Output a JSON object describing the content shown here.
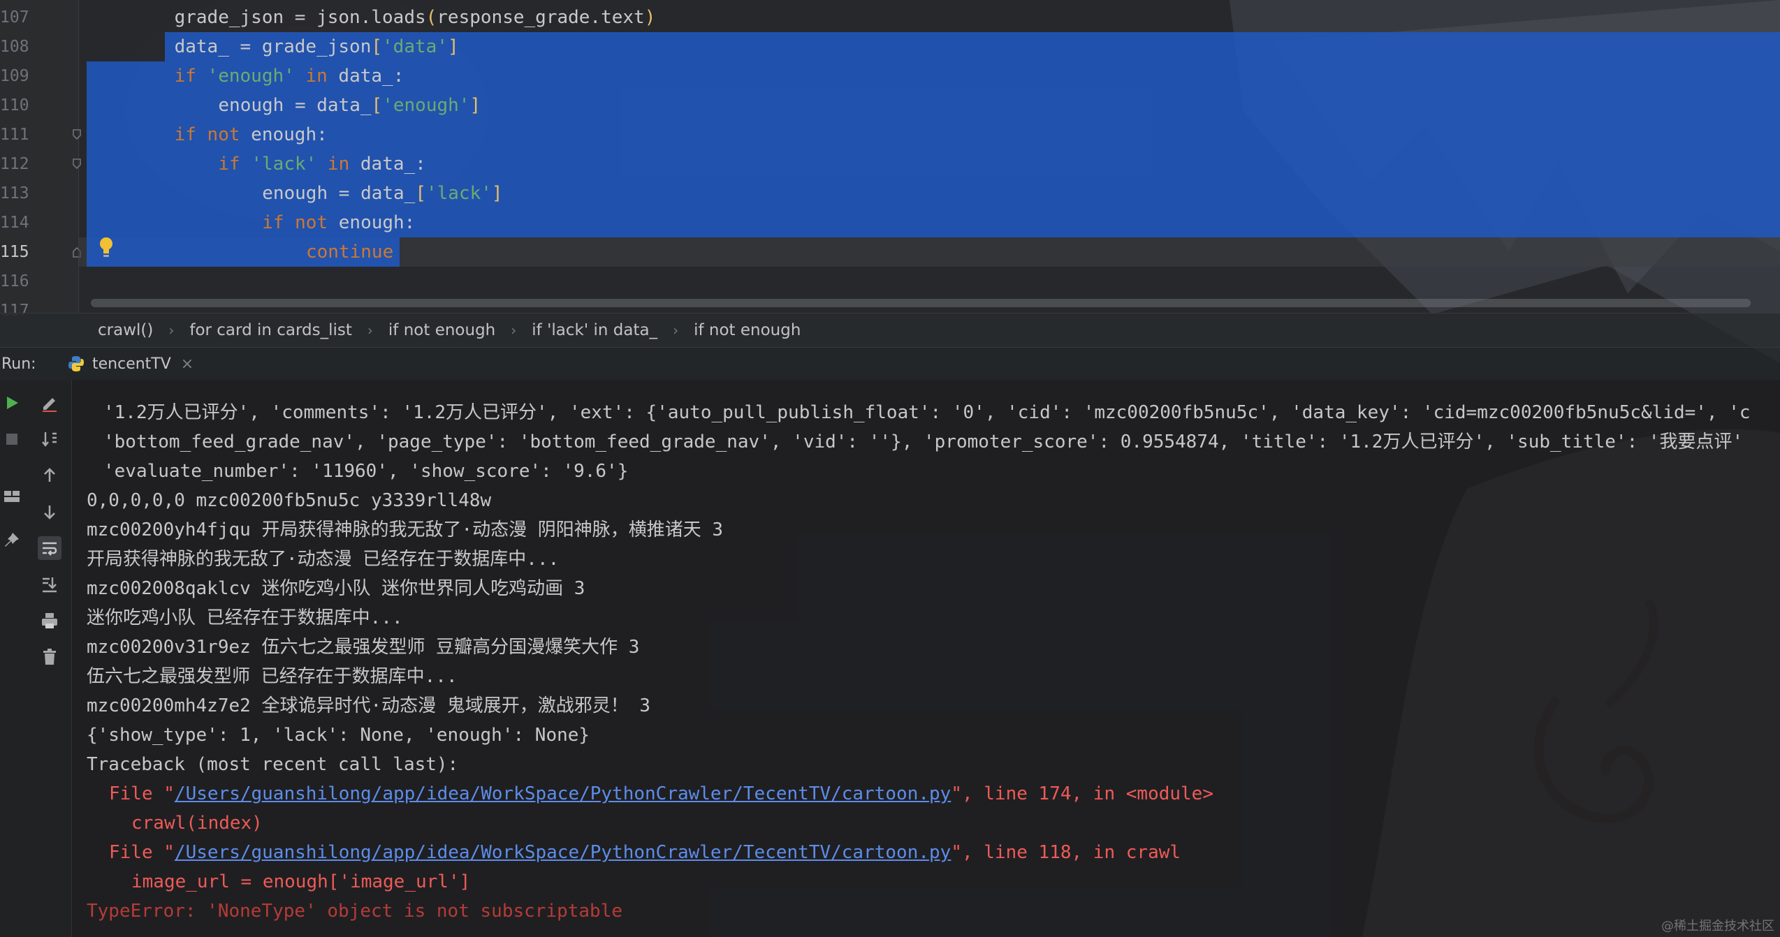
{
  "editor": {
    "line_numbers": [
      "107",
      "108",
      "109",
      "110",
      "111",
      "112",
      "113",
      "114",
      "115",
      "116",
      "117"
    ],
    "lines": [
      {
        "indent": 8,
        "tokens": [
          {
            "t": "grade_json = json.loads",
            "c": ""
          },
          {
            "t": "(",
            "c": "br"
          },
          {
            "t": "response_grade.text",
            "c": ""
          },
          {
            "t": ")",
            "c": "br"
          }
        ]
      },
      {
        "indent": 8,
        "tokens": [
          {
            "t": "data_ = grade_json",
            "c": ""
          },
          {
            "t": "[",
            "c": "br"
          },
          {
            "t": "'data'",
            "c": "str"
          },
          {
            "t": "]",
            "c": "br"
          }
        ]
      },
      {
        "indent": 8,
        "tokens": [
          {
            "t": "if ",
            "c": "kw"
          },
          {
            "t": "'enough'",
            "c": "str"
          },
          {
            "t": " in ",
            "c": "kw"
          },
          {
            "t": "data_:",
            "c": ""
          }
        ]
      },
      {
        "indent": 12,
        "tokens": [
          {
            "t": "enough = data_",
            "c": ""
          },
          {
            "t": "[",
            "c": "br"
          },
          {
            "t": "'enough'",
            "c": "str"
          },
          {
            "t": "]",
            "c": "br"
          }
        ]
      },
      {
        "indent": 8,
        "tokens": [
          {
            "t": "if not ",
            "c": "kw"
          },
          {
            "t": "enough:",
            "c": ""
          }
        ]
      },
      {
        "indent": 12,
        "tokens": [
          {
            "t": "if ",
            "c": "kw"
          },
          {
            "t": "'lack'",
            "c": "str"
          },
          {
            "t": " in ",
            "c": "kw"
          },
          {
            "t": "data_:",
            "c": ""
          }
        ]
      },
      {
        "indent": 16,
        "tokens": [
          {
            "t": "enough = data_",
            "c": ""
          },
          {
            "t": "[",
            "c": "br"
          },
          {
            "t": "'lack'",
            "c": "str"
          },
          {
            "t": "]",
            "c": "br"
          }
        ]
      },
      {
        "indent": 16,
        "tokens": [
          {
            "t": "if not ",
            "c": "kw"
          },
          {
            "t": "enough:",
            "c": ""
          }
        ]
      },
      {
        "indent": 20,
        "tokens": [
          {
            "t": "continue",
            "c": "kw"
          }
        ]
      },
      {
        "indent": 0,
        "tokens": []
      },
      {
        "indent": 0,
        "tokens": []
      }
    ]
  },
  "breadcrumb": {
    "items": [
      "crawl()",
      "for card in cards_list",
      "if not enough",
      "if 'lack' in data_",
      "if not enough"
    ],
    "separator": "›"
  },
  "run": {
    "label": "Run:",
    "tab_name": "tencentTV",
    "close_glyph": "×"
  },
  "toolbar": {
    "tools": [
      "rerun-icon",
      "edit-config-icon",
      "stop-icon",
      "sort-icon",
      "scroll-up-icon",
      "layout-icon",
      "scroll-down-icon",
      "pin-icon",
      "soft-wrap-icon",
      "scroll-to-end-icon",
      "print-icon",
      "clear-icon"
    ]
  },
  "console": {
    "lines": [
      {
        "indent": 1,
        "segments": [
          {
            "t": "'1.2万人已评分', 'comments': '1.2万人已评分', 'ext': {'auto_pull_publish_float': '0', 'cid': 'mzc00200fb5nu5c', 'data_key': 'cid=mzc00200fb5nu5c&lid=', 'c",
            "c": ""
          }
        ]
      },
      {
        "indent": 1,
        "segments": [
          {
            "t": "'bottom_feed_grade_nav', 'page_type': 'bottom_feed_grade_nav', 'vid': ''}, 'promoter_score': 0.9554874, 'title': '1.2万人已评分', 'sub_title': '我要点评'",
            "c": ""
          }
        ]
      },
      {
        "indent": 1,
        "segments": [
          {
            "t": "'evaluate_number': '11960', 'show_score': '9.6'}",
            "c": ""
          }
        ]
      },
      {
        "indent": 0,
        "segments": [
          {
            "t": "0,0,0,0,0 mzc00200fb5nu5c y3339rll48w",
            "c": ""
          }
        ]
      },
      {
        "indent": 0,
        "segments": [
          {
            "t": "mzc00200yh4fjqu 开局获得神脉的我无敌了·动态漫 阴阳神脉，横推诸天 3",
            "c": ""
          }
        ]
      },
      {
        "indent": 0,
        "segments": [
          {
            "t": "开局获得神脉的我无敌了·动态漫 已经存在于数据库中...",
            "c": ""
          }
        ]
      },
      {
        "indent": 0,
        "segments": [
          {
            "t": "mzc002008qaklcv 迷你吃鸡小队 迷你世界同人吃鸡动画 3",
            "c": ""
          }
        ]
      },
      {
        "indent": 0,
        "segments": [
          {
            "t": "迷你吃鸡小队 已经存在于数据库中...",
            "c": ""
          }
        ]
      },
      {
        "indent": 0,
        "segments": [
          {
            "t": "mzc00200v31r9ez 伍六七之最强发型师 豆瓣高分国漫爆笑大作 3",
            "c": ""
          }
        ]
      },
      {
        "indent": 0,
        "segments": [
          {
            "t": "伍六七之最强发型师 已经存在于数据库中...",
            "c": ""
          }
        ]
      },
      {
        "indent": 0,
        "segments": [
          {
            "t": "mzc00200mh4z7e2 全球诡异时代·动态漫 鬼域展开，激战邪灵！ 3",
            "c": ""
          }
        ]
      },
      {
        "indent": 0,
        "segments": [
          {
            "t": "{'show_type': 1, 'lack': None, 'enough': None}",
            "c": ""
          }
        ]
      },
      {
        "indent": 0,
        "segments": [
          {
            "t": "Traceback (most recent call last):",
            "c": ""
          }
        ]
      },
      {
        "indent": 2,
        "segments": [
          {
            "t": "File \"",
            "c": "err"
          },
          {
            "t": "/Users/guanshilong/app/idea/WorkSpace/PythonCrawler/TecentTV/cartoon.py",
            "c": "err-link"
          },
          {
            "t": "\", line 174, in <module>",
            "c": "err"
          }
        ]
      },
      {
        "indent": 4,
        "segments": [
          {
            "t": "crawl(index)",
            "c": "err"
          }
        ]
      },
      {
        "indent": 2,
        "segments": [
          {
            "t": "File \"",
            "c": "err"
          },
          {
            "t": "/Users/guanshilong/app/idea/WorkSpace/PythonCrawler/TecentTV/cartoon.py",
            "c": "err-link"
          },
          {
            "t": "\", line 118, in crawl",
            "c": "err"
          }
        ]
      },
      {
        "indent": 4,
        "segments": [
          {
            "t": "image_url = enough['image_url']",
            "c": "err"
          }
        ]
      },
      {
        "indent": 0,
        "segments": [
          {
            "t": "TypeError: 'NoneType' object is not subscriptable",
            "c": "err-final"
          }
        ]
      }
    ]
  },
  "watermark": "@稀土掘金技术社区",
  "colors": {
    "selection": "#2058bf",
    "keyword": "#cc7832",
    "string": "#6aab73",
    "bracket": "#e8bf6a",
    "error": "#ee5b56",
    "link": "#5d8de8"
  }
}
